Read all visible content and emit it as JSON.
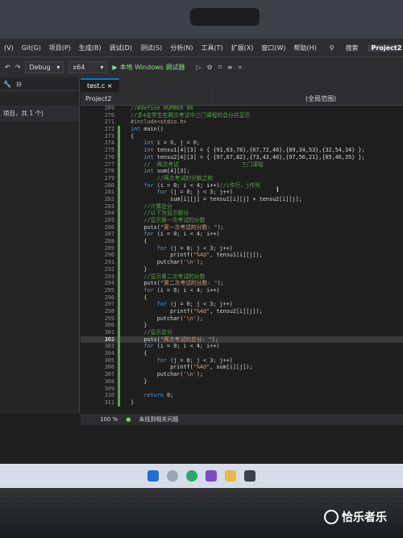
{
  "menubar": {
    "items": [
      "(V)",
      "Git(G)",
      "项目(P)",
      "生成(B)",
      "调试(D)",
      "测试(S)",
      "分析(N)",
      "工具(T)",
      "扩展(X)",
      "窗口(W)",
      "帮助(H)"
    ],
    "search_label": "搜索",
    "project_badge": "Project2"
  },
  "toolbar": {
    "config": "Debug",
    "platform": "x64",
    "run_label": "本地 Windows 调试器"
  },
  "left_panel": {
    "item_label": "项目，共 1 个)"
  },
  "editor": {
    "tab_label": "test.c",
    "nav_project": "Project2",
    "nav_scope": "(全局范围)"
  },
  "code_lines": [
    {
      "n": "269",
      "parts": [
        [
          "c",
          "//#define NUMBER 60"
        ]
      ]
    },
    {
      "n": "270",
      "parts": [
        [
          "c",
          "//求4名学生在两次考试中三门课程的总分并显示"
        ]
      ]
    },
    {
      "n": "271",
      "parts": [
        [
          "p",
          "#include"
        ],
        [
          "s",
          "<stdio.h>"
        ]
      ]
    },
    {
      "n": "272",
      "parts": [
        [
          "k",
          "int"
        ],
        [
          "txt",
          " main()"
        ]
      ]
    },
    {
      "n": "273",
      "parts": [
        [
          "txt",
          "{"
        ]
      ]
    },
    {
      "n": "274",
      "parts": [
        [
          "txt",
          "    "
        ],
        [
          "k",
          "int"
        ],
        [
          "txt",
          " i = "
        ],
        [
          "n",
          "0"
        ],
        [
          "txt",
          ", j = "
        ],
        [
          "n",
          "0"
        ],
        [
          "txt",
          ";"
        ]
      ]
    },
    {
      "n": "275",
      "parts": [
        [
          "txt",
          "    "
        ],
        [
          "k",
          "int"
        ],
        [
          "txt",
          " tensu1[4][3] = { {91,63,78},{67,72,46},{89,34,53},{32,54,34} };"
        ]
      ]
    },
    {
      "n": "276",
      "parts": [
        [
          "txt",
          "    "
        ],
        [
          "k",
          "int"
        ],
        [
          "txt",
          " tensu2[4][3] = { {97,67,82},{73,43,46},{97,56,21},{85,46,35} };"
        ]
      ]
    },
    {
      "n": "277",
      "parts": [
        [
          "txt",
          "    "
        ],
        [
          "c",
          "//  两次考试                   三门课程"
        ]
      ]
    },
    {
      "n": "278",
      "parts": [
        [
          "txt",
          "    "
        ],
        [
          "k",
          "int"
        ],
        [
          "txt",
          " sum[4][3];"
        ]
      ]
    },
    {
      "n": "279",
      "parts": [
        [
          "txt",
          "        "
        ],
        [
          "c",
          "//两次考试的分数之和"
        ]
      ]
    },
    {
      "n": "280",
      "parts": [
        [
          "txt",
          "    "
        ],
        [
          "k",
          "for"
        ],
        [
          "txt",
          " (i = 0; i < 4; i++)"
        ],
        [
          "c",
          "//i作行，j作列"
        ]
      ]
    },
    {
      "n": "281",
      "parts": [
        [
          "txt",
          "        "
        ],
        [
          "k",
          "for"
        ],
        [
          "txt",
          " (j = 0; j < 3; j++)"
        ]
      ]
    },
    {
      "n": "282",
      "parts": [
        [
          "txt",
          "            sum[i][j] = tensu1[i][j] + tensu2[i][j];"
        ]
      ]
    },
    {
      "n": "283",
      "parts": [
        [
          "txt",
          "    "
        ],
        [
          "c",
          "//计算总分"
        ]
      ]
    },
    {
      "n": "284",
      "parts": [
        [
          "txt",
          "    "
        ],
        [
          "c",
          "//以下为显示部分"
        ]
      ]
    },
    {
      "n": "285",
      "parts": [
        [
          "txt",
          "    "
        ],
        [
          "c",
          "//显示第一次考试的分数"
        ]
      ]
    },
    {
      "n": "286",
      "parts": [
        [
          "txt",
          "    puts("
        ],
        [
          "s",
          "\"第一次考试的分数: \""
        ],
        [
          "txt",
          ");"
        ]
      ]
    },
    {
      "n": "287",
      "parts": [
        [
          "txt",
          "    "
        ],
        [
          "k",
          "for"
        ],
        [
          "txt",
          " (i = 0; i < 4; i++)"
        ]
      ]
    },
    {
      "n": "288",
      "parts": [
        [
          "txt",
          "    {"
        ]
      ]
    },
    {
      "n": "289",
      "parts": [
        [
          "txt",
          "        "
        ],
        [
          "k",
          "for"
        ],
        [
          "txt",
          " (j = 0; j < 3; j++)"
        ]
      ]
    },
    {
      "n": "290",
      "parts": [
        [
          "txt",
          "            printf("
        ],
        [
          "s",
          "\"%4d\""
        ],
        [
          "txt",
          ", tensu1[i][j]);"
        ]
      ]
    },
    {
      "n": "291",
      "parts": [
        [
          "txt",
          "        putchar("
        ],
        [
          "s",
          "'\\n'"
        ],
        [
          "txt",
          ");"
        ]
      ]
    },
    {
      "n": "292",
      "parts": [
        [
          "txt",
          "    }"
        ]
      ]
    },
    {
      "n": "293",
      "parts": [
        [
          "txt",
          "    "
        ],
        [
          "c",
          "//显示第二次考试的分数"
        ]
      ]
    },
    {
      "n": "294",
      "parts": [
        [
          "txt",
          "    puts("
        ],
        [
          "s",
          "\"第二次考试的分数: \""
        ],
        [
          "txt",
          ");"
        ]
      ]
    },
    {
      "n": "295",
      "parts": [
        [
          "txt",
          "    "
        ],
        [
          "k",
          "for"
        ],
        [
          "txt",
          " (i = 0; i < 4; i++)"
        ]
      ]
    },
    {
      "n": "296",
      "parts": [
        [
          "txt",
          "    {"
        ]
      ]
    },
    {
      "n": "297",
      "parts": [
        [
          "txt",
          "        "
        ],
        [
          "k",
          "for"
        ],
        [
          "txt",
          " (j = 0; j < 3; j++)"
        ]
      ]
    },
    {
      "n": "298",
      "parts": [
        [
          "txt",
          "            printf("
        ],
        [
          "s",
          "\"%4d\""
        ],
        [
          "txt",
          ", tensu2[i][j]);"
        ]
      ]
    },
    {
      "n": "299",
      "parts": [
        [
          "txt",
          "        putchar("
        ],
        [
          "s",
          "'\\n'"
        ],
        [
          "txt",
          ");"
        ]
      ]
    },
    {
      "n": "300",
      "parts": [
        [
          "txt",
          "    }"
        ]
      ]
    },
    {
      "n": "301",
      "parts": [
        [
          "txt",
          "    "
        ],
        [
          "c",
          "//显示总分"
        ]
      ]
    },
    {
      "n": "302",
      "cur": true,
      "parts": [
        [
          "txt",
          "    puts("
        ],
        [
          "s",
          "\"两次考试的总分: \""
        ],
        [
          "txt",
          ");"
        ]
      ]
    },
    {
      "n": "303",
      "parts": [
        [
          "txt",
          "    "
        ],
        [
          "k",
          "for"
        ],
        [
          "txt",
          " (i = 0; i < 4; i++)"
        ]
      ]
    },
    {
      "n": "304",
      "parts": [
        [
          "txt",
          "    {"
        ]
      ]
    },
    {
      "n": "305",
      "parts": [
        [
          "txt",
          "        "
        ],
        [
          "k",
          "for"
        ],
        [
          "txt",
          " (j = 0; j < 3; j++)"
        ]
      ]
    },
    {
      "n": "306",
      "parts": [
        [
          "txt",
          "            printf("
        ],
        [
          "s",
          "\"%4d\""
        ],
        [
          "txt",
          ", sum[i][j]);"
        ]
      ]
    },
    {
      "n": "307",
      "parts": [
        [
          "txt",
          "        putchar("
        ],
        [
          "s",
          "'\\n'"
        ],
        [
          "txt",
          ");"
        ]
      ]
    },
    {
      "n": "308",
      "parts": [
        [
          "txt",
          "    }"
        ]
      ]
    },
    {
      "n": "309",
      "parts": [
        [
          "txt",
          ""
        ]
      ]
    },
    {
      "n": "310",
      "parts": [
        [
          "txt",
          "    "
        ],
        [
          "k",
          "return"
        ],
        [
          "txt",
          " 0;"
        ]
      ]
    },
    {
      "n": "311",
      "parts": [
        [
          "txt",
          "}"
        ]
      ]
    }
  ],
  "statusbar": {
    "zoom": "100 %",
    "issues": "未找到相关问题"
  },
  "watermark": {
    "text": "恰乐者乐"
  }
}
